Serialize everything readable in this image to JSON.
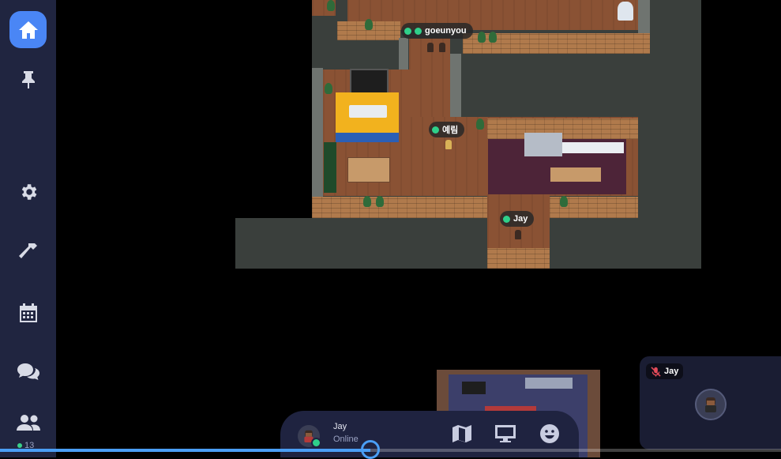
{
  "sidebar": {
    "items": [
      {
        "icon": "home-icon",
        "active": true
      },
      {
        "icon": "pin-icon",
        "active": false
      },
      {
        "icon": "gear-icon",
        "active": false
      },
      {
        "icon": "hammer-icon",
        "active": false
      },
      {
        "icon": "calendar-icon",
        "active": false
      },
      {
        "icon": "chat-icon",
        "active": false
      },
      {
        "icon": "people-icon",
        "active": false
      }
    ],
    "online_count": "13"
  },
  "map": {
    "players": [
      {
        "name": "goeunyou"
      },
      {
        "name": "예림"
      },
      {
        "name": "Jay"
      }
    ]
  },
  "video": {
    "name": "Jay",
    "mic_muted": true
  },
  "bottom_bar": {
    "user_name": "Jay",
    "user_status": "Online",
    "buttons": [
      "map-icon",
      "screen-share-icon",
      "emoji-icon"
    ]
  },
  "playback": {
    "progress": 0.474
  },
  "colors": {
    "accent": "#4a86f5",
    "online": "#2fd08a",
    "sidebar_bg": "#202540",
    "progress": "#4a9ef5"
  }
}
